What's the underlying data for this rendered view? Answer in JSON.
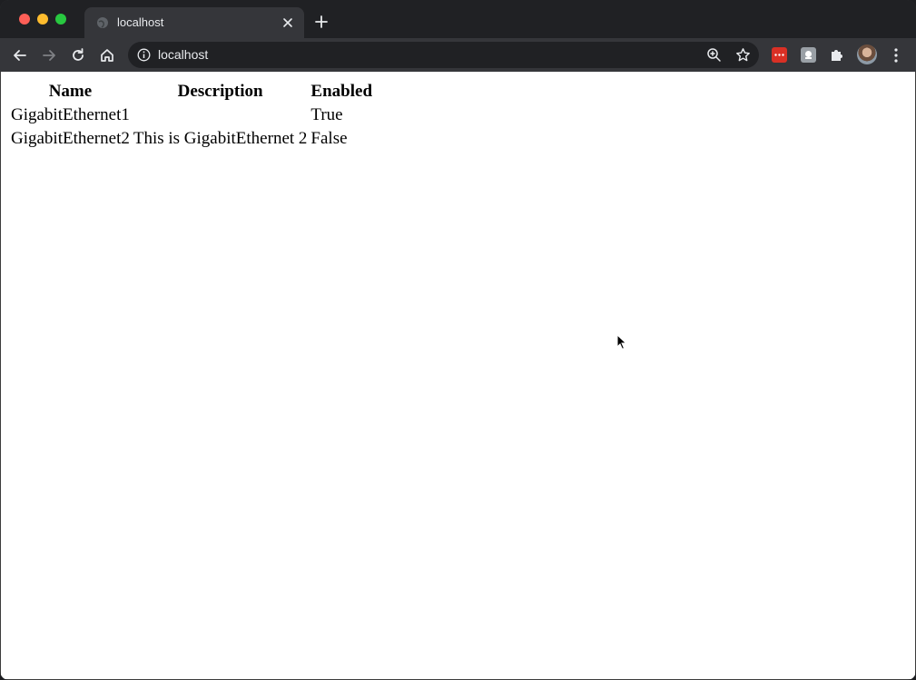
{
  "browser": {
    "tab_title": "localhost",
    "url": "localhost"
  },
  "icons": {
    "tab_favicon": "globe-icon",
    "tab_close": "close-icon",
    "new_tab": "plus-icon",
    "back": "arrow-left-icon",
    "forward": "arrow-right-icon",
    "reload": "reload-icon",
    "home": "home-icon",
    "site_info": "info-icon",
    "zoom": "zoom-icon",
    "bookmark": "star-icon",
    "extension_red": "password-manager-icon",
    "extension_grey": "extension-icon",
    "extensions": "puzzle-icon",
    "profile": "avatar",
    "menu": "kebab-menu-icon"
  },
  "colors": {
    "chrome_dark": "#202124",
    "toolbar": "#35363a",
    "text_light": "#e8eaed",
    "page_bg": "#ffffff"
  },
  "table": {
    "headers": [
      "Name",
      "Description",
      "Enabled"
    ],
    "rows": [
      [
        "GigabitEthernet1",
        "",
        "True"
      ],
      [
        "GigabitEthernet2",
        "This is GigabitEthernet 2",
        "False"
      ]
    ]
  }
}
